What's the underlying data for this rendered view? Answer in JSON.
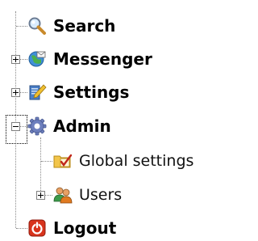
{
  "tree": {
    "items": [
      {
        "label": "Search",
        "icon": "magnifier-icon"
      },
      {
        "label": "Messenger",
        "icon": "globe-mail-icon",
        "expander": "plus"
      },
      {
        "label": "Settings",
        "icon": "settings-pen-icon",
        "expander": "plus"
      },
      {
        "label": "Admin",
        "icon": "gear-icon",
        "expander": "minus",
        "children": [
          {
            "label": "Global settings",
            "icon": "folder-check-icon"
          },
          {
            "label": "Users",
            "icon": "users-icon",
            "expander": "plus"
          }
        ]
      },
      {
        "label": "Logout",
        "icon": "power-icon"
      }
    ]
  },
  "colors": {
    "connector": "#8a8a8a",
    "text": "#000000",
    "logout_red": "#d8331c",
    "folder_yellow": "#f2c54b",
    "gear_blue": "#5a6fb0"
  }
}
